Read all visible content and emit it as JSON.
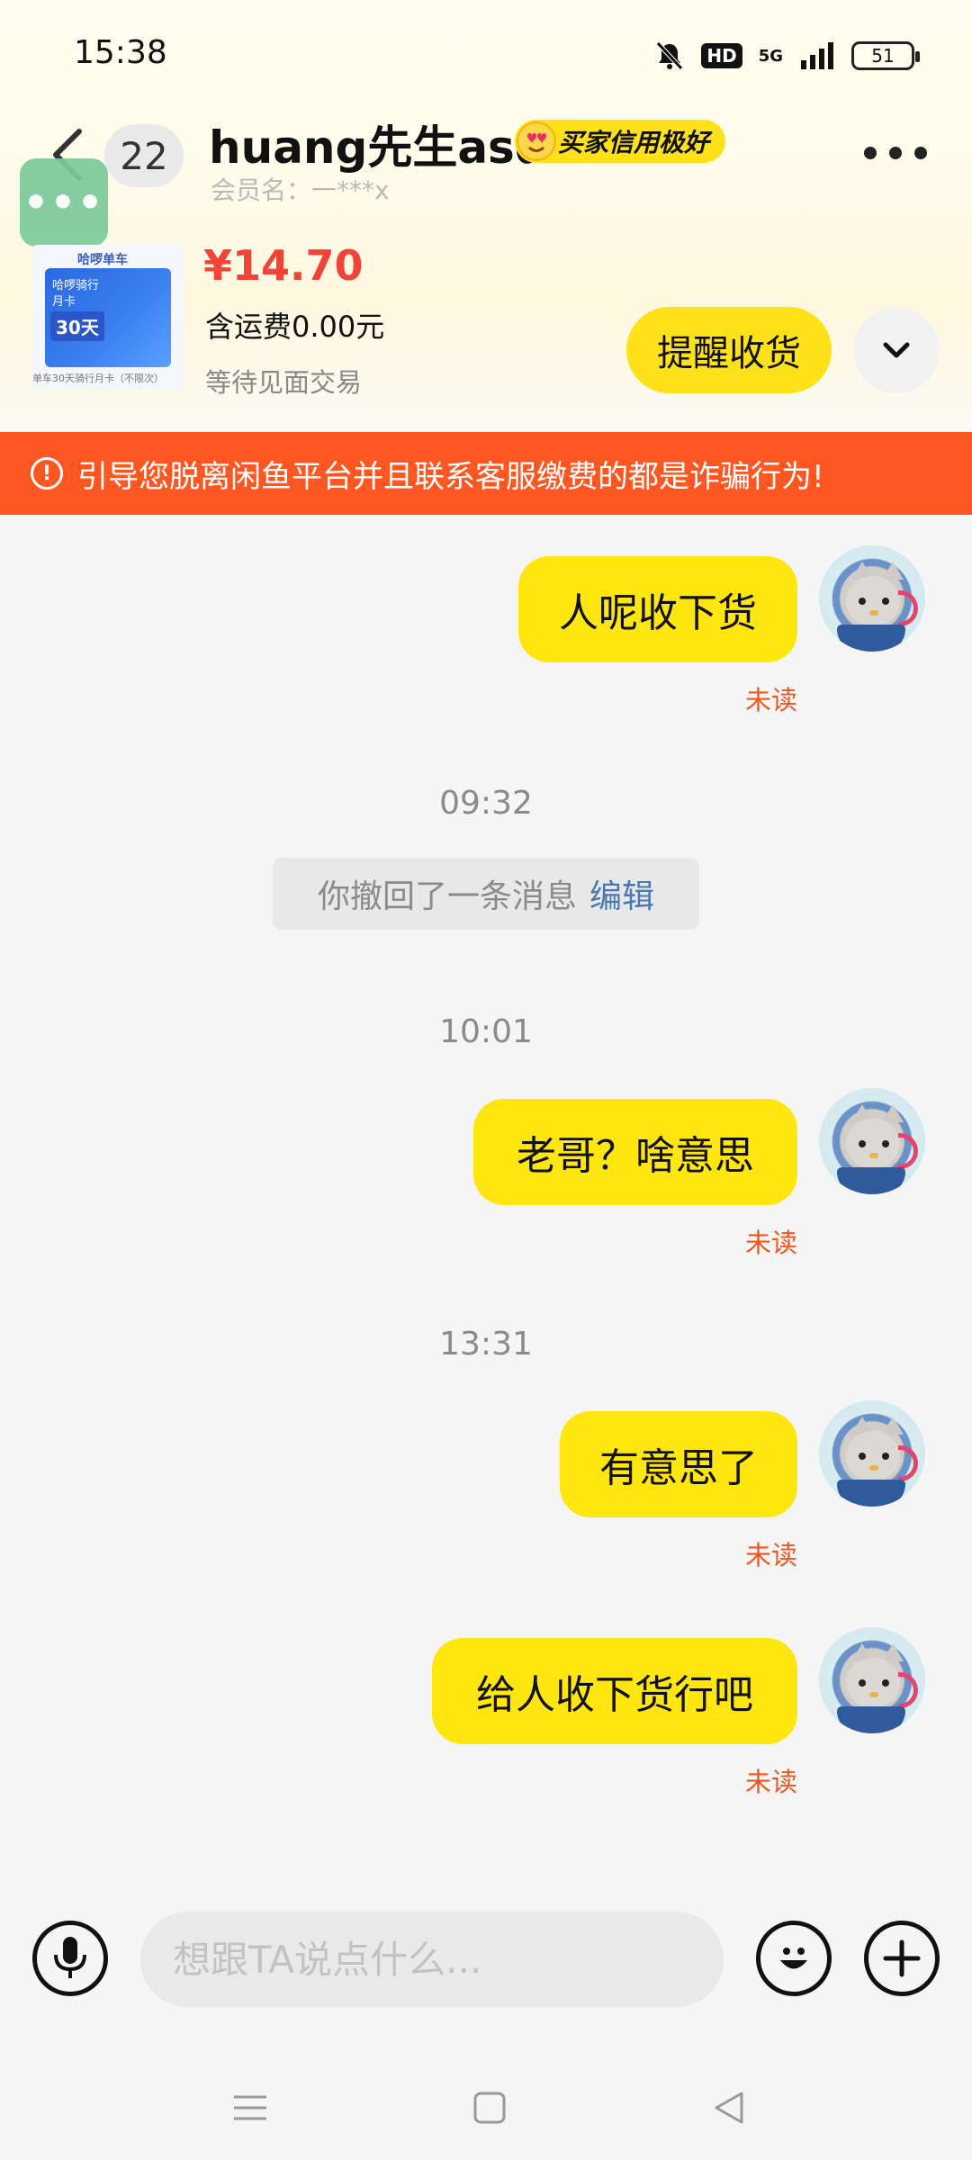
{
  "status_bar": {
    "time": "15:38",
    "hd": "HD",
    "network": "5G",
    "battery": "51",
    "icons": [
      "mute-icon",
      "hd-icon",
      "signal-icon",
      "battery-icon"
    ]
  },
  "header": {
    "unread_count": "22",
    "float_button_label": "•••",
    "contact_name": "huang先生asd",
    "credit_badge": "买家信用极好",
    "member_name": "会员名：一***x"
  },
  "product": {
    "thumb_brand": "哈啰单车",
    "thumb_title": "哈啰骑行",
    "thumb_subtitle": "月卡",
    "thumb_days": "30天",
    "thumb_caption": "单车30天骑行月卡（不限次）",
    "price": "¥14.70",
    "shipping": "含运费0.00元",
    "status": "等待见面交易",
    "remind_button": "提醒收货"
  },
  "warning": {
    "icon": "!",
    "text": "引导您脱离闲鱼平台并且联系客服缴费的都是诈骗行为!"
  },
  "chat": {
    "messages": [
      {
        "text": "人呢收下货",
        "status": "未读"
      },
      {
        "text": "老哥？啥意思",
        "status": "未读"
      },
      {
        "text": "有意思了",
        "status": "未读"
      },
      {
        "text": "给人收下货行吧",
        "status": "未读"
      }
    ],
    "timestamps": [
      "09:32",
      "10:01",
      "13:31"
    ],
    "recall": {
      "text": "你撤回了一条消息",
      "edit": "编辑"
    }
  },
  "input": {
    "placeholder": "想跟TA说点什么..."
  },
  "colors": {
    "accent_yellow": "#ffe60f",
    "warning_orange": "#ff5722",
    "price_red": "#f04438",
    "unread_orange": "#f0571f"
  }
}
